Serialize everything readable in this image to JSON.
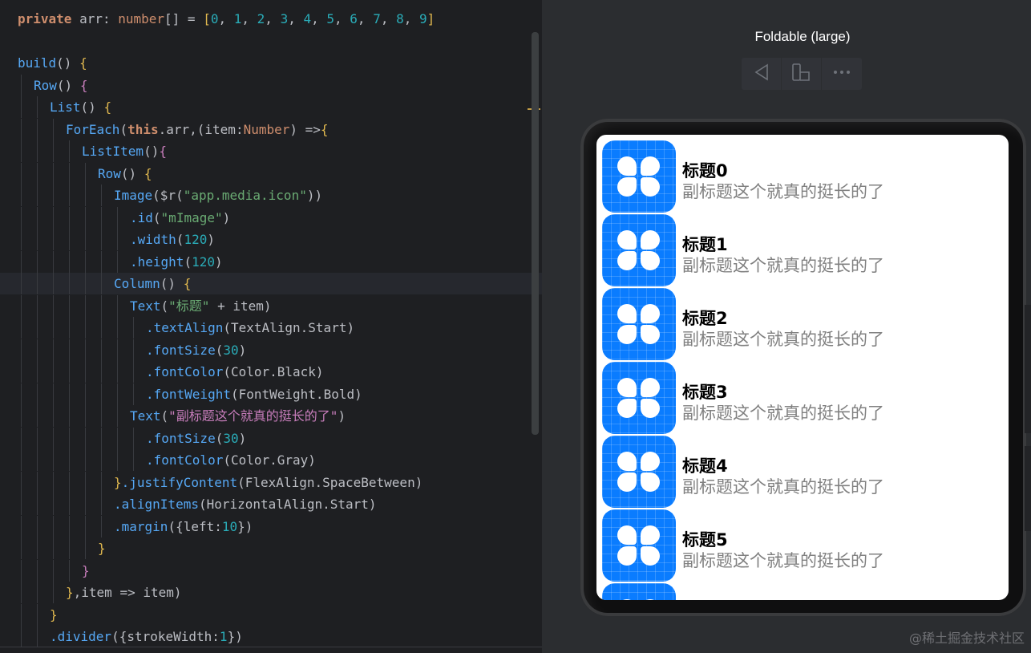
{
  "editor": {
    "highlight_line": 12,
    "lines": [
      {
        "indent": 0,
        "tokens": [
          [
            "kw",
            "private"
          ],
          [
            "id",
            " arr"
          ],
          [
            "pun",
            ": "
          ],
          [
            "typ",
            "number"
          ],
          [
            "pun",
            "[] = "
          ],
          [
            "brk",
            "["
          ],
          [
            "num",
            "0"
          ],
          [
            "pun",
            ", "
          ],
          [
            "num",
            "1"
          ],
          [
            "pun",
            ", "
          ],
          [
            "num",
            "2"
          ],
          [
            "pun",
            ", "
          ],
          [
            "num",
            "3"
          ],
          [
            "pun",
            ", "
          ],
          [
            "num",
            "4"
          ],
          [
            "pun",
            ", "
          ],
          [
            "num",
            "5"
          ],
          [
            "pun",
            ", "
          ],
          [
            "num",
            "6"
          ],
          [
            "pun",
            ", "
          ],
          [
            "num",
            "7"
          ],
          [
            "pun",
            ", "
          ],
          [
            "num",
            "8"
          ],
          [
            "pun",
            ", "
          ],
          [
            "num",
            "9"
          ],
          [
            "brk",
            "]"
          ]
        ]
      },
      {
        "indent": 0,
        "tokens": []
      },
      {
        "indent": 0,
        "tokens": [
          [
            "fn",
            "build"
          ],
          [
            "pun",
            "() "
          ],
          [
            "brk",
            "{"
          ]
        ]
      },
      {
        "indent": 1,
        "tokens": [
          [
            "fn",
            "Row"
          ],
          [
            "pun",
            "() "
          ],
          [
            "brk2",
            "{"
          ]
        ]
      },
      {
        "indent": 2,
        "tokens": [
          [
            "fn",
            "List"
          ],
          [
            "pun",
            "() "
          ],
          [
            "brk",
            "{"
          ]
        ]
      },
      {
        "indent": 3,
        "tokens": [
          [
            "fn",
            "ForEach"
          ],
          [
            "pun",
            "("
          ],
          [
            "kw",
            "this"
          ],
          [
            "pun",
            ".arr,(item:"
          ],
          [
            "typ",
            "Number"
          ],
          [
            "pun",
            ") =>"
          ],
          [
            "brk",
            "{"
          ]
        ]
      },
      {
        "indent": 4,
        "tokens": [
          [
            "fn",
            "ListItem"
          ],
          [
            "pun",
            "()"
          ],
          [
            "brk2",
            "{"
          ]
        ]
      },
      {
        "indent": 5,
        "tokens": [
          [
            "fn",
            "Row"
          ],
          [
            "pun",
            "() "
          ],
          [
            "brk",
            "{"
          ]
        ]
      },
      {
        "indent": 6,
        "tokens": [
          [
            "fn",
            "Image"
          ],
          [
            "pun",
            "($r("
          ],
          [
            "str",
            "\"app.media.icon\""
          ],
          [
            "pun",
            "))"
          ]
        ]
      },
      {
        "indent": 7,
        "tokens": [
          [
            "attr",
            ".id"
          ],
          [
            "pun",
            "("
          ],
          [
            "str",
            "\"mImage\""
          ],
          [
            "pun",
            ")"
          ]
        ]
      },
      {
        "indent": 7,
        "tokens": [
          [
            "attr",
            ".width"
          ],
          [
            "pun",
            "("
          ],
          [
            "num",
            "120"
          ],
          [
            "pun",
            ")"
          ]
        ]
      },
      {
        "indent": 7,
        "tokens": [
          [
            "attr",
            ".height"
          ],
          [
            "pun",
            "("
          ],
          [
            "num",
            "120"
          ],
          [
            "pun",
            ")"
          ]
        ]
      },
      {
        "indent": 6,
        "tokens": [
          [
            "fn",
            "Column"
          ],
          [
            "pun",
            "() "
          ],
          [
            "brk",
            "{"
          ]
        ]
      },
      {
        "indent": 7,
        "tokens": [
          [
            "fn",
            "Text"
          ],
          [
            "pun",
            "("
          ],
          [
            "str",
            "\"标题\""
          ],
          [
            "pun",
            " + item)"
          ]
        ]
      },
      {
        "indent": 8,
        "tokens": [
          [
            "attr",
            ".textAlign"
          ],
          [
            "pun",
            "(TextAlign.Start)"
          ]
        ]
      },
      {
        "indent": 8,
        "tokens": [
          [
            "attr",
            ".fontSize"
          ],
          [
            "pun",
            "("
          ],
          [
            "num",
            "30"
          ],
          [
            "pun",
            ")"
          ]
        ]
      },
      {
        "indent": 8,
        "tokens": [
          [
            "attr",
            ".fontColor"
          ],
          [
            "pun",
            "(Color.Black)"
          ]
        ]
      },
      {
        "indent": 8,
        "tokens": [
          [
            "attr",
            ".fontWeight"
          ],
          [
            "pun",
            "(FontWeight.Bold)"
          ]
        ]
      },
      {
        "indent": 7,
        "tokens": [
          [
            "fn",
            "Text"
          ],
          [
            "pun",
            "("
          ],
          [
            "strpurple",
            "\"副标题这个就真的挺长的了\""
          ],
          [
            "pun",
            ")"
          ]
        ]
      },
      {
        "indent": 8,
        "tokens": [
          [
            "attr",
            ".fontSize"
          ],
          [
            "pun",
            "("
          ],
          [
            "num",
            "30"
          ],
          [
            "pun",
            ")"
          ]
        ]
      },
      {
        "indent": 8,
        "tokens": [
          [
            "attr",
            ".fontColor"
          ],
          [
            "pun",
            "(Color.Gray)"
          ]
        ]
      },
      {
        "indent": 6,
        "tokens": [
          [
            "brk",
            "}"
          ],
          [
            "attr",
            ".justifyContent"
          ],
          [
            "pun",
            "(FlexAlign.SpaceBetween)"
          ]
        ]
      },
      {
        "indent": 6,
        "tokens": [
          [
            "attr",
            ".alignItems"
          ],
          [
            "pun",
            "(HorizontalAlign.Start)"
          ]
        ]
      },
      {
        "indent": 6,
        "tokens": [
          [
            "attr",
            ".margin"
          ],
          [
            "pun",
            "({left:"
          ],
          [
            "num",
            "10"
          ],
          [
            "pun",
            "})"
          ]
        ]
      },
      {
        "indent": 5,
        "tokens": [
          [
            "brk",
            "}"
          ]
        ]
      },
      {
        "indent": 4,
        "tokens": [
          [
            "brk2",
            "}"
          ]
        ]
      },
      {
        "indent": 3,
        "tokens": [
          [
            "brk",
            "}"
          ],
          [
            "pun",
            ",item => item)"
          ]
        ]
      },
      {
        "indent": 2,
        "tokens": [
          [
            "brk",
            "}"
          ]
        ]
      },
      {
        "indent": 2,
        "tokens": [
          [
            "attr",
            ".divider"
          ],
          [
            "pun",
            "({strokeWidth:"
          ],
          [
            "num",
            "1"
          ],
          [
            "pun",
            "})"
          ]
        ]
      }
    ]
  },
  "preview": {
    "device_label": "Foldable (large)",
    "toolbar": {
      "back_icon": "back-triangle-icon",
      "rotate_icon": "fold-device-icon",
      "more_icon": "more-dots-icon"
    },
    "items": [
      {
        "title": "标题0",
        "subtitle": "副标题这个就真的挺长的了"
      },
      {
        "title": "标题1",
        "subtitle": "副标题这个就真的挺长的了"
      },
      {
        "title": "标题2",
        "subtitle": "副标题这个就真的挺长的了"
      },
      {
        "title": "标题3",
        "subtitle": "副标题这个就真的挺长的了"
      },
      {
        "title": "标题4",
        "subtitle": "副标题这个就真的挺长的了"
      },
      {
        "title": "标题5",
        "subtitle": "副标题这个就真的挺长的了"
      },
      {
        "title": "",
        "subtitle": ""
      }
    ]
  },
  "watermark": "@稀土掘金技术社区",
  "colors": {
    "icon_blue": "#0a7cff",
    "editor_bg": "#1e1f22",
    "preview_bg": "#2b2d30"
  }
}
